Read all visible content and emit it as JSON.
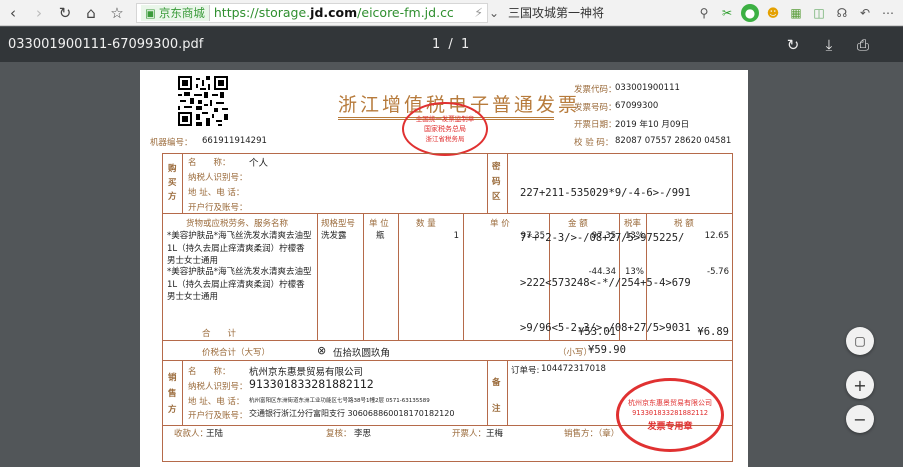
{
  "browser": {
    "site_label": "京东商城",
    "url_scheme": "https://",
    "url_host_pre": "storage.",
    "url_host_bold": "jd.com",
    "url_path": "/eicore-fm.jd.cc",
    "search_text": "三国攻城第一神将",
    "lightning_icon": "⚡"
  },
  "pdf": {
    "filename": "033001900111-67099300.pdf",
    "page_current": "1",
    "page_sep": "/",
    "page_total": "1"
  },
  "invoice": {
    "title": "浙江增值税电子普通发票",
    "machine_no_label": "机器编号：",
    "machine_no": "661911914291",
    "code_label": "发票代码：",
    "code": "033001900111",
    "number_label": "发票号码：",
    "number": "67099300",
    "date_label": "开票日期：",
    "date": "2019 年10 月09日",
    "check_label": "校 验 码：",
    "check": "82087 07557 28620 04581",
    "buyer_side_label": "购买方",
    "buyer_name_label": "名　　称：",
    "buyer_name": "个人",
    "buyer_tax_label": "纳税人识别号：",
    "buyer_addr_label": "地 址、电 话：",
    "buyer_bank_label": "开户行及账号：",
    "cipher_side_label": "密码区",
    "cipher_lines": [
      "227+211-535029*9/-4-6>-/991",
      "7*+-2-3/>-/08+27/5>975225/",
      ">222<573248<-*//254+5-4>679",
      ">9/96<5-2-3/>-/08+27/5>9031"
    ],
    "col_goods": "货物或应税劳务、服务名称",
    "col_spec": "规格型号",
    "col_unit": "单 位",
    "col_qty": "数 量",
    "col_price": "单 价",
    "col_amount": "金 额",
    "col_rate": "税率",
    "col_tax": "税 额",
    "items": [
      {
        "name": "*美容护肤品*海飞丝洗发水清爽去油型1L（持久去屑止痒清爽柔润）柠檬香 男士女士通用",
        "spec": "洗发露",
        "unit": "瓶",
        "qty": "1",
        "price": "97.35",
        "amount": "97.35",
        "rate": "13%",
        "tax": "12.65"
      },
      {
        "name": "*美容护肤品*海飞丝洗发水清爽去油型1L（持久去屑止痒清爽柔润）柠檬香 男士女士通用",
        "spec": "",
        "unit": "",
        "qty": "",
        "price": "",
        "amount": "-44.34",
        "rate": "13%",
        "tax": "-5.76"
      }
    ],
    "total_label": "合　　计",
    "total_amount": "¥53.01",
    "total_tax": "¥6.89",
    "sum_label": "价税合计（大写）",
    "sum_words": "伍拾玖圆玖角",
    "sum_small_label": "（小写）",
    "sum_small": "¥59.90",
    "seller_side_label": "销售方",
    "seller_name_label": "名　　称：",
    "seller_name": "杭州京东惠景贸易有限公司",
    "seller_tax_label": "纳税人识别号：",
    "seller_tax": "913301833281882112",
    "seller_addr_label": "地 址、电 话：",
    "seller_addr": "杭州富阳区东洲街道东洲工业功能区七号路38号1幢2层 0571-63135589",
    "seller_bank_label": "开户行及账号：",
    "seller_bank": "交通银行浙江分行富阳支行 306068860018170182120",
    "remark_side_label": "备注",
    "order_label": "订单号:",
    "order": "104472317018",
    "payee_label": "收款人：",
    "payee": "王陆",
    "reviewer_label": "复核：",
    "reviewer": "李思",
    "drawer_label": "开票人：",
    "drawer": "王梅",
    "seller_stamp_label": "销售方：（章）",
    "stamp_top_text": "全国统一发票监制章",
    "stamp_top_sub": "国家税务总局",
    "stamp_top_bottom": "浙江省税务局",
    "stamp_company": "杭州京东惠景贸易有限公司",
    "stamp_taxno": "913301833281882112",
    "stamp_label": "发票专用章"
  }
}
